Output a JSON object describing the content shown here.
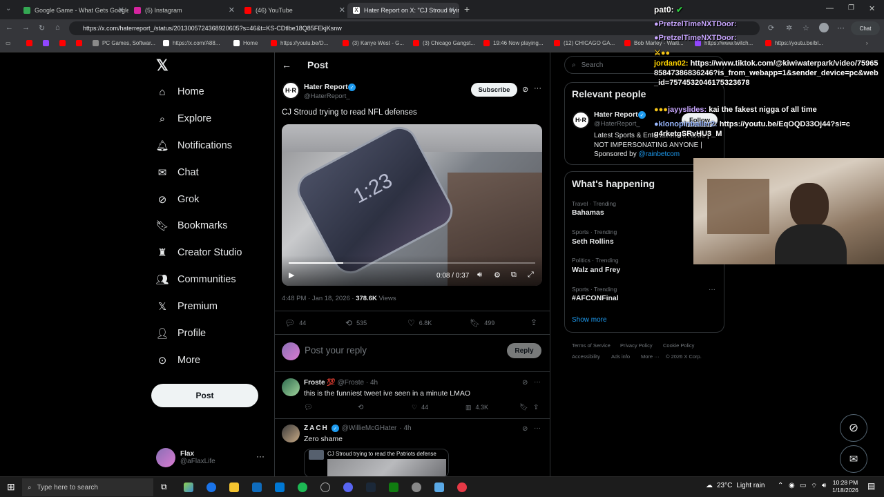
{
  "browser": {
    "tabs": [
      {
        "title": "Google Game - What Gets Google",
        "color": "#34a853"
      },
      {
        "title": "(5) Instagram",
        "color": "#d6249f"
      },
      {
        "title": "(46) YouTube",
        "color": "#ff0000"
      },
      {
        "title": "Hater Report on X: \"CJ Stroud tryin",
        "color": "#ffffff"
      }
    ],
    "url": "https://x.com/haterreport_/status/2013005724368920605?s=46&t=KS-CDtlbe18Q85FEkjKsnw",
    "bookmarks": [
      "PC Games, Softwar...",
      "https://x.com/A88...",
      "Home",
      "https://youtu.be/D...",
      "(3) Kanye West - G...",
      "(3) Chicago Gangst...",
      "19:46 Now playing...",
      "(12) CHICAGO GA...",
      "Bob Marley - Waiti...",
      "https://www.twitch...",
      "https://youtu.be/bl..."
    ]
  },
  "sidebar": {
    "items": [
      "Home",
      "Explore",
      "Notifications",
      "Chat",
      "Grok",
      "Bookmarks",
      "Creator Studio",
      "Communities",
      "Premium",
      "Profile",
      "More"
    ],
    "post_label": "Post",
    "user": {
      "name": "Flax",
      "handle": "@aFlaxLife"
    }
  },
  "post": {
    "header": "Post",
    "author": "Hater Report",
    "handle": "@HaterReport_",
    "subscribe": "Subscribe",
    "text": "CJ Stroud trying to read NFL defenses",
    "video_time": "0:08 / 0:37",
    "phone_time": "1:23",
    "timestamp": "4:48 PM · Jan 18, 2026 · ",
    "views_count": "378.6K",
    "views_label": " Views",
    "replies": "44",
    "reposts": "535",
    "likes": "6.8K",
    "bookmarks": "499",
    "reply_placeholder": "Post your reply",
    "reply_button": "Reply",
    "progress": 0.22
  },
  "replies": [
    {
      "name": "Froste",
      "emoji": "💯",
      "handle": "@Froste",
      "time": "· 4h",
      "text": "this is the funniest tweet ive seen in a minute LMAO",
      "likes": "44",
      "views": "4.3K"
    },
    {
      "name": "ZACH",
      "handle": "@WillieMcGHater",
      "time": "· 4h",
      "text": "Zero shame",
      "quote": "CJ Stroud trying to read the Patriots defense"
    }
  ],
  "right": {
    "search": "Search",
    "relevant_title": "Relevant people",
    "person_name": "Hater Report",
    "person_handle": "@HaterReport_",
    "follow": "Follow",
    "bio": "Latest Sports & Entertainment News | NOT IMPERSONATING ANYONE | Sponsored by ",
    "bio_link": "@rainbetcom",
    "happening_title": "What's happening",
    "trends": [
      {
        "cat": "Travel · Trending",
        "name": "Bahamas"
      },
      {
        "cat": "Sports · Trending",
        "name": "Seth Rollins"
      },
      {
        "cat": "Politics · Trending",
        "name": "Walz and Frey"
      },
      {
        "cat": "Sports · Trending",
        "name": "#AFCONFinal"
      }
    ],
    "show_more": "Show more",
    "footer": [
      "Terms of Service",
      "Privacy Policy",
      "Cookie Policy",
      "Accessibility",
      "Ads info",
      "More ···",
      "© 2026 X Corp."
    ]
  },
  "overlay": {
    "streamer": "pat0:",
    "chat": [
      {
        "user": "PretzelTimeNXTDoor:",
        "msg": ""
      },
      {
        "user": "PretzelTimeNXTDoor:",
        "msg": ""
      },
      {
        "user": "jordan02:",
        "msg": "https://www.tiktok.com/@kiwiwaterpark/video/7596585847386836246?is_from_webapp=1&sender_device=pc&web_id=7574532046175323678"
      },
      {
        "user": "jayyslides:",
        "msg": "kai the fakest nigga of all time"
      },
      {
        "user": "klonopinballer2:",
        "msg": "https://youtu.be/EqOQD33Oj44?si=cg4rketgSRvHU3_M"
      }
    ]
  },
  "taskbar": {
    "search_placeholder": "Type here to search",
    "weather_temp": "23°C",
    "weather_desc": "Light rain",
    "time": "10:28 PM",
    "date": "1/18/2026"
  },
  "colors": {
    "accent": "#1d9bf0",
    "verified": "#1d9bf0",
    "bg": "#000000",
    "border": "#2f3336"
  }
}
